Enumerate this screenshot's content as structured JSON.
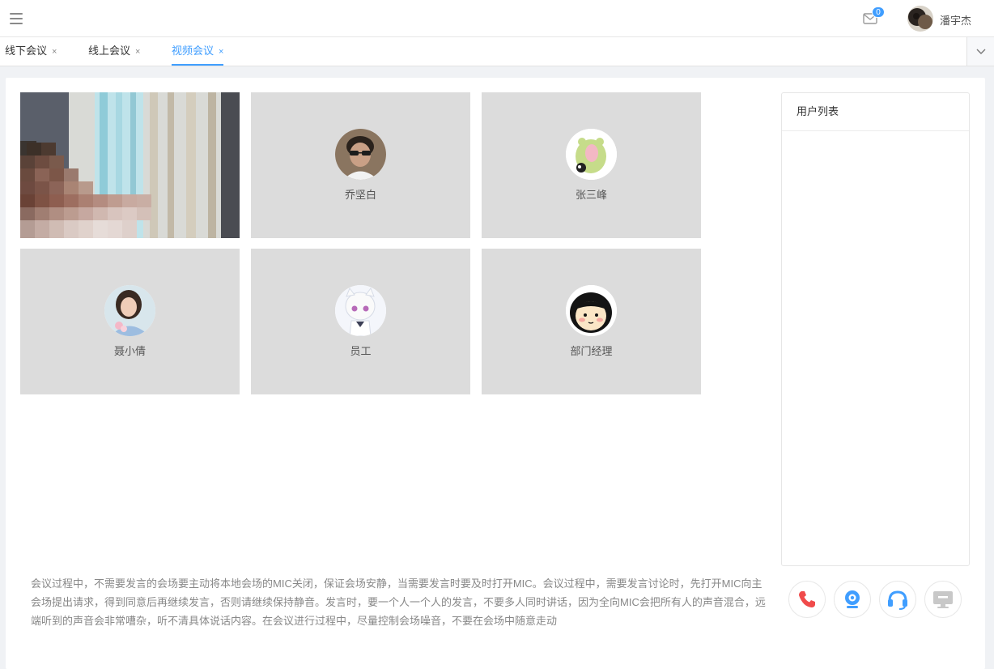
{
  "header": {
    "mail_count": "0",
    "user_name": "潘宇杰"
  },
  "tabs": [
    {
      "label": "线下会议",
      "close": "×"
    },
    {
      "label": "线上会议",
      "close": "×"
    },
    {
      "label": "视频会议",
      "close": "×",
      "active": true
    }
  ],
  "participants": [
    {
      "name": "乔坚白",
      "avatar": "avatar-photo-man-sunglasses"
    },
    {
      "name": "张三峰",
      "avatar": "avatar-cartoon-frog"
    },
    {
      "name": "聂小倩",
      "avatar": "avatar-photo-woman"
    },
    {
      "name": "员工",
      "avatar": "avatar-anime-girl"
    },
    {
      "name": "部门经理",
      "avatar": "avatar-cartoon-girl"
    }
  ],
  "user_list": {
    "title": "用户列表"
  },
  "notice": "会议过程中，不需要发言的会场要主动将本地会场的MIC关闭，保证会场安静，当需要发言时要及时打开MIC。会议过程中，需要发言讨论时，先打开MIC向主会场提出请求，得到同意后再继续发言，否则请继续保持静音。发言时，要一个人一个人的发言，不要多人同时讲话，因为全向MIC会把所有人的声音混合，远端听到的声音会非常嘈杂，听不清具体说话内容。在会议进行过程中，尽量控制会场噪音，不要在会场中随意走动",
  "controls": [
    {
      "icon": "phone-icon",
      "color": "#f04b4b"
    },
    {
      "icon": "webcam-icon",
      "color": "#409eff"
    },
    {
      "icon": "headset-icon",
      "color": "#409eff"
    },
    {
      "icon": "screen-share-icon",
      "color": "#c8c8c8"
    }
  ],
  "colors": {
    "accent": "#409eff",
    "danger": "#f04b4b",
    "tile_bg": "#dcdcdc"
  }
}
